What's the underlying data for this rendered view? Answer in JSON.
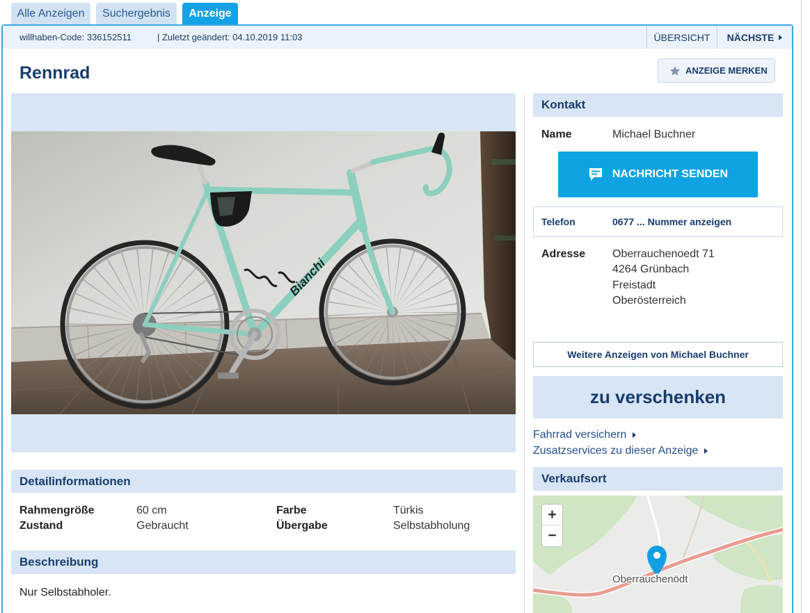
{
  "tabs": [
    {
      "label": "Alle Anzeigen",
      "active": false
    },
    {
      "label": "Suchergebnis",
      "active": false
    },
    {
      "label": "Anzeige",
      "active": true
    }
  ],
  "header": {
    "code": "willhaben-Code: 336152511",
    "changed": "| Zuletzt geändert: 04.10.2019 11:03",
    "overview_label": "ÜBERSICHT",
    "next_label": "NÄCHSTE"
  },
  "ad": {
    "title": "Rennrad",
    "save_label": "ANZEIGE MERKEN",
    "photo_lettering": "Bianchi"
  },
  "details": {
    "heading": "Detailinformationen",
    "items": [
      {
        "label": "Rahmengröße",
        "value": "60 cm"
      },
      {
        "label": "Farbe",
        "value": "Türkis"
      },
      {
        "label": "Zustand",
        "value": "Gebraucht"
      },
      {
        "label": "Übergabe",
        "value": "Selbstabholung"
      }
    ]
  },
  "description": {
    "heading": "Beschreibung",
    "text": "Nur Selbstabholer."
  },
  "contact": {
    "heading": "Kontakt",
    "name_label": "Name",
    "name": "Michael Buchner",
    "message_button": "NACHRICHT SENDEN",
    "phone_label": "Telefon",
    "phone_reveal": "0677 ... Nummer anzeigen",
    "address_label": "Adresse",
    "address_lines": [
      "Oberrauchenoedt 71",
      "4264 Grünbach",
      "Freistadt",
      "Oberösterreich"
    ],
    "more_ads": "Weitere Anzeigen von Michael Buchner"
  },
  "price": "zu verschenken",
  "links": [
    {
      "label": "Fahrrad versichern"
    },
    {
      "label": "Zusatzservices zu dieser Anzeige"
    }
  ],
  "location": {
    "heading": "Verkaufsort",
    "zoom_in": "+",
    "zoom_out": "−",
    "place_label": "Oberrauchenödt"
  },
  "icons": {
    "save": "star-icon",
    "message": "chat-bubble-icon",
    "next": "chevron-right-icon",
    "links": "chevron-right-icon",
    "map_marker": "map-marker-icon"
  },
  "colors": {
    "accent": "#13a2e3",
    "heading": "#183c6e",
    "section_background": "#d7e5f4",
    "frame_color": "#8ccfbf"
  }
}
